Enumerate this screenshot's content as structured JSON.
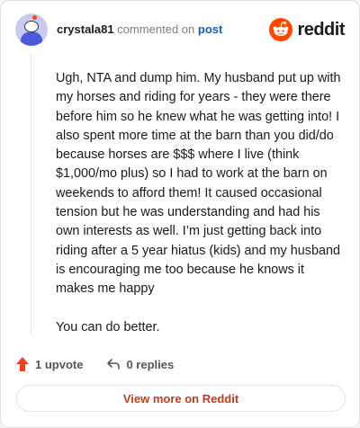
{
  "comment": {
    "author": "crystala81",
    "verb": "commented on",
    "target_link": "post",
    "paragraphs": [
      "Ugh, NTA and dump him. My husband put up with my horses and riding for years - they were there before him so he knew what he was getting into! I also spent more time at the barn than you did/do because horses are $$$ where I live (think $1,000/mo plus) so I had to work at the barn on weekends to afford them! It caused occasional tension but he was understanding and had his own interests as well. I’m just getting back into riding after a 5 year hiatus (kids) and my husband is encouraging me too because he knows it makes me happy",
      "You can do better."
    ]
  },
  "brand": {
    "wordmark": "reddit",
    "icon": "reddit-logo-icon",
    "color": "#ff4500"
  },
  "actions": {
    "upvote_icon": "upvote-arrow-icon",
    "upvote_label": "1 upvote",
    "reply_icon": "reply-arrow-icon",
    "replies_label": "0 replies"
  },
  "footer": {
    "more_label": "View more on Reddit"
  }
}
